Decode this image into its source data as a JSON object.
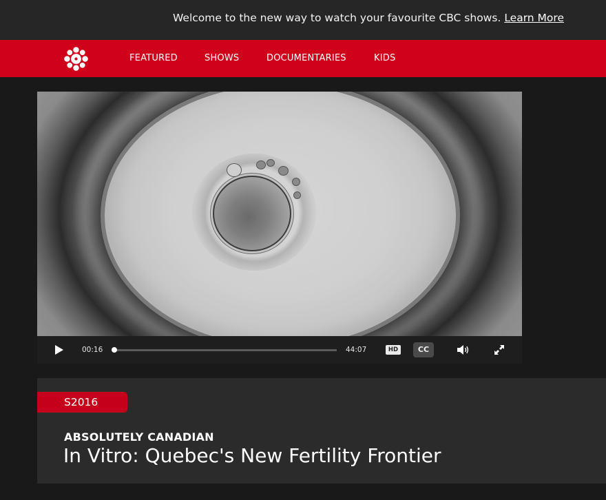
{
  "banner": {
    "message": "Welcome to the new way to watch your favourite CBC shows.",
    "link_label": "Learn More"
  },
  "nav": {
    "logo_icon": "cbc-gem-logo",
    "items": [
      {
        "label": "FEATURED"
      },
      {
        "label": "SHOWS"
      },
      {
        "label": "DOCUMENTARIES"
      },
      {
        "label": "KIDS"
      }
    ]
  },
  "player": {
    "current_time": "00:16",
    "total_time": "44:07",
    "progress_fraction": 0.006,
    "hd_label": "HD",
    "cc_label": "CC",
    "icons": [
      "play-icon",
      "volume-icon",
      "fullscreen-icon"
    ]
  },
  "episode": {
    "season_label": "S2016",
    "show_name": "ABSOLUTELY CANADIAN",
    "title": "In Vitro: Quebec's New Fertility Frontier"
  },
  "colors": {
    "brand_red": "#d0021b",
    "background": "#191919",
    "panel": "#2b2b2b"
  }
}
